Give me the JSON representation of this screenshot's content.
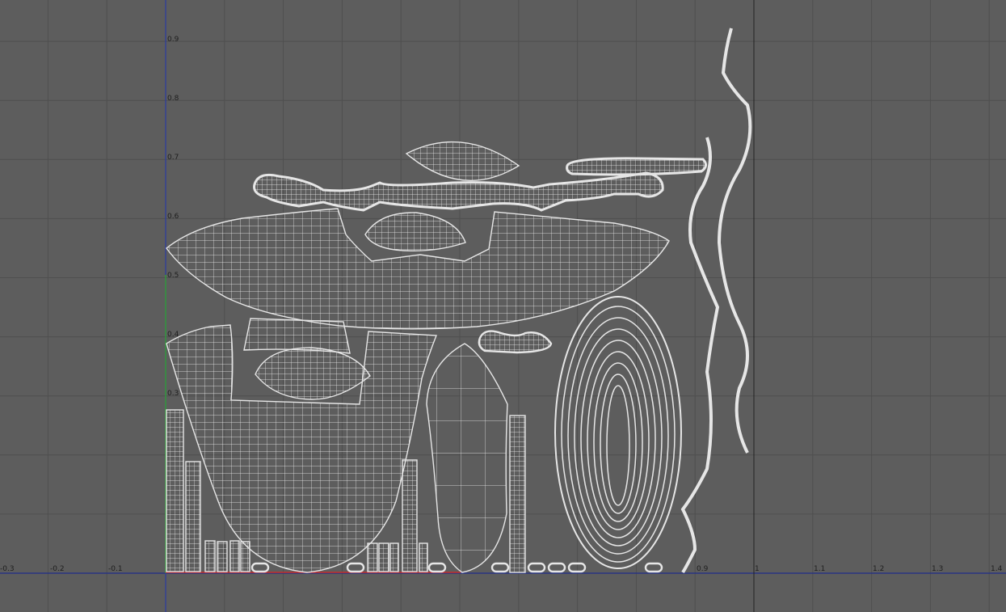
{
  "uv_editor": {
    "background_color": "#5d5d5d",
    "grid_color": "#4f4f4f",
    "u_axis_color": "#1f2d8a",
    "v_axis_color": "#2b3aa0",
    "wire_color": "#f0f0f0",
    "shell_outline_color": "#d9d9d9",
    "u_ticks": [
      "-0.3",
      "-0.2",
      "-0.1",
      "0.9",
      "1",
      "1.1",
      "1.2",
      "1.3",
      "1.4"
    ],
    "v_ticks": [
      "0.9",
      "0.8",
      "0.7",
      "0.6",
      "0.5",
      "0.4",
      "0.3"
    ]
  }
}
